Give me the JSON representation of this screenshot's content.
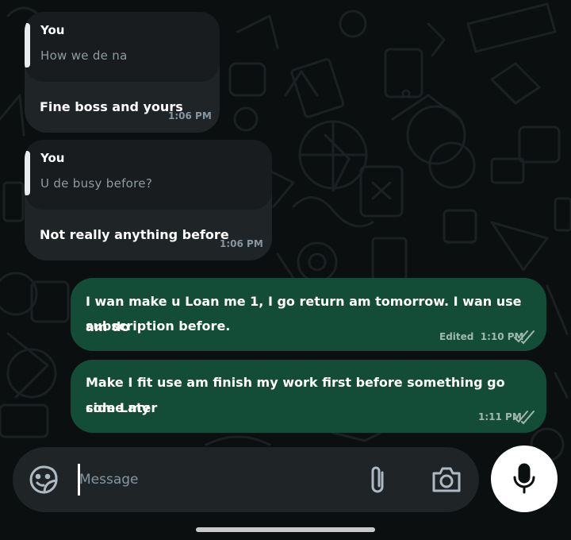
{
  "messages": [
    {
      "direction": "incoming",
      "quote": {
        "author": "You",
        "text": "How we de na"
      },
      "text": "Fine boss and yours",
      "time": "1:06 PM"
    },
    {
      "direction": "incoming",
      "quote": {
        "author": "You",
        "text": "U de busy before?"
      },
      "text": "Not really anything before",
      "time": "1:06 PM"
    },
    {
      "direction": "outgoing",
      "lines": [
        "I wan make u Loan me 1, I go return am tomorrow. I wan use am do",
        "subscription before."
      ],
      "time": "Edited  1:10 PM",
      "status_icon": "double-check-icon"
    },
    {
      "direction": "outgoing",
      "lines": [
        "Make I fit use am finish my work first before something go come my",
        "side Later"
      ],
      "time": "1:11 PM",
      "status_icon": "double-check-icon"
    }
  ],
  "composer": {
    "placeholder": "Message",
    "icons": [
      "sticker-icon",
      "paperclip-icon",
      "camera-icon",
      "microphone-icon"
    ]
  },
  "colors": {
    "background": "#0b0f10",
    "incoming_bubble": "#1f2427",
    "outgoing_bubble": "#144d37",
    "quote_background": "#181c1e",
    "time_text": "#8696a0"
  }
}
